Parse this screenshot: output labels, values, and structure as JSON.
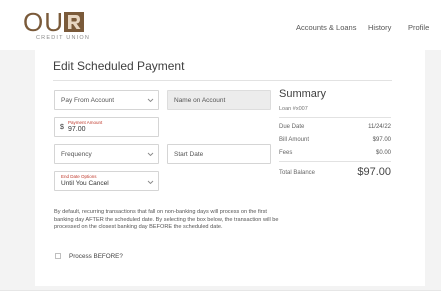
{
  "logo": {
    "mark_text": "OU",
    "subtitle": "CREDIT UNION"
  },
  "nav": {
    "items": [
      {
        "label": "Accounts & Loans"
      },
      {
        "label": "History"
      },
      {
        "label": "Profile"
      }
    ]
  },
  "page": {
    "title": "Edit Scheduled Payment"
  },
  "form": {
    "pay_from": {
      "placeholder": "Pay From Account"
    },
    "name_on_account": {
      "placeholder": "Name on Account"
    },
    "payment_amount": {
      "label": "Payment Amount",
      "currency": "$",
      "value": "97.00"
    },
    "frequency": {
      "placeholder": "Frequency"
    },
    "start_date": {
      "placeholder": "Start Date"
    },
    "end_date": {
      "label": "End Date Options",
      "value": "Until You Cancel"
    }
  },
  "summary": {
    "title": "Summary",
    "loan": "Loan #x007",
    "rows": [
      {
        "label": "Due Date",
        "value": "11/24/22"
      },
      {
        "label": "Bill Amount",
        "value": "$97.00"
      },
      {
        "label": "Fees",
        "value": "$0.00"
      }
    ],
    "total_label": "Total Balance",
    "total_value": "$97.00"
  },
  "disclaimer": "By default, recurring transactions that fall on non-banking days will process on the first banking day AFTER the scheduled date. By selecting the box below, the transaction will be processed on the closest banking day BEFORE the scheduled date.",
  "process_before": {
    "label": "Process BEFORE?",
    "checked": false
  },
  "colors": {
    "brand": "#7a5a3a",
    "accent_red": "#c0392b",
    "background": "#f3f3f3"
  }
}
